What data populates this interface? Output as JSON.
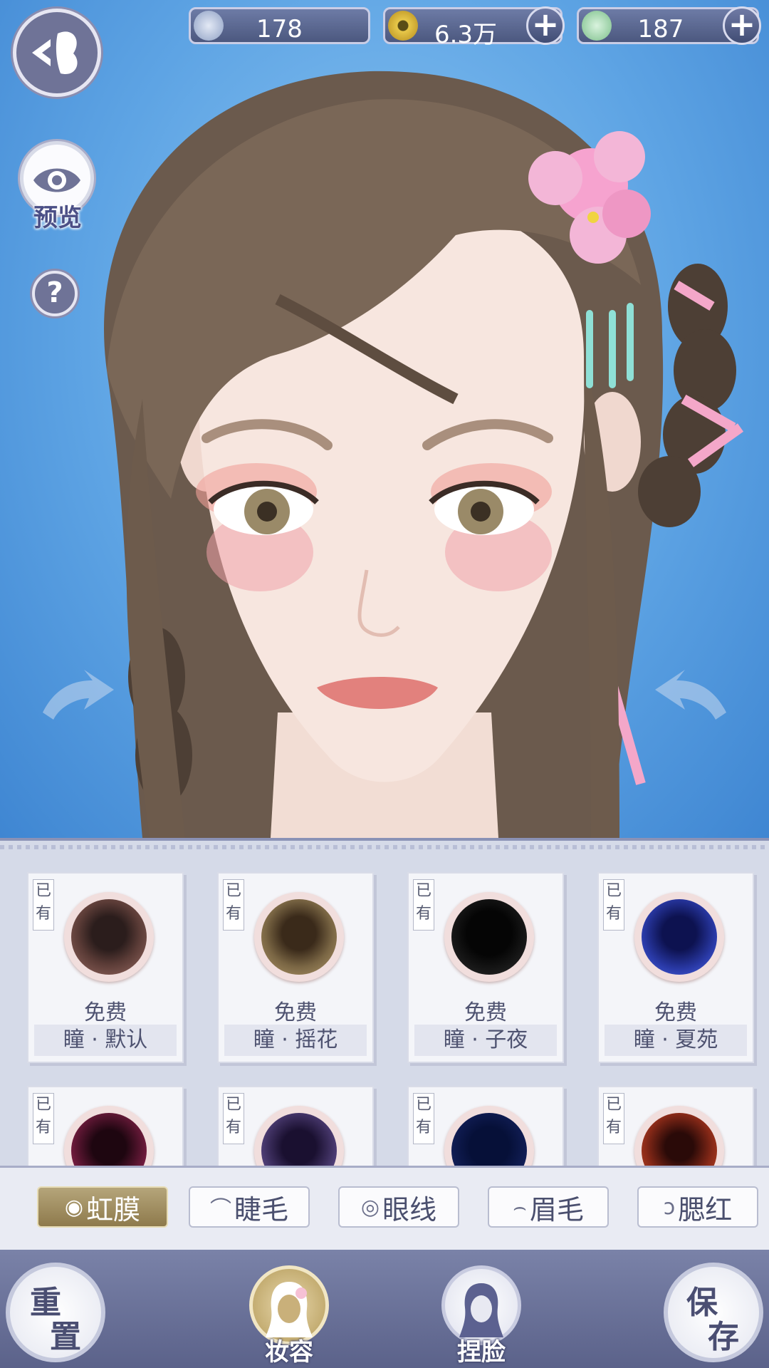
{
  "currency": [
    {
      "icon": "silver-coin-icon",
      "value": "178",
      "has_plus": false
    },
    {
      "icon": "gold-coin-icon",
      "value": "6.3万",
      "has_plus": true
    },
    {
      "icon": "jade-coin-icon",
      "value": "187",
      "has_plus": true
    }
  ],
  "left_controls": {
    "back_icon": "back-butterfly-icon",
    "preview_label": "预览",
    "help_label": "?"
  },
  "items_row1": [
    {
      "owned": "已有",
      "price": "免费",
      "name": "瞳 · 默认",
      "color_inner": "#2b1d1c",
      "color_ring": "#9a6b63"
    },
    {
      "owned": "已有",
      "price": "免费",
      "name": "瞳 · 摇花",
      "color_inner": "#3a2a1a",
      "color_ring": "#b39a6a"
    },
    {
      "owned": "已有",
      "price": "免费",
      "name": "瞳 · 子夜",
      "color_inner": "#050505",
      "color_ring": "#2e2e2e"
    },
    {
      "owned": "已有",
      "price": "免费",
      "name": "瞳 · 夏苑",
      "color_inner": "#0d1250",
      "color_ring": "#4d6be6"
    }
  ],
  "items_row2": [
    {
      "owned": "已有",
      "color_inner": "#1e0610",
      "color_ring": "#b0306a"
    },
    {
      "owned": "已有",
      "color_inner": "#1a1030",
      "color_ring": "#7a5aa8"
    },
    {
      "owned": "已有",
      "color_inner": "#061038",
      "color_ring": "#22357a"
    },
    {
      "owned": "已有",
      "color_inner": "#2a0a08",
      "color_ring": "#d0502a"
    }
  ],
  "tabs": [
    {
      "label": "虹膜",
      "icon": "iris-icon",
      "active": true
    },
    {
      "label": "睫毛",
      "icon": "eyelash-icon",
      "active": false
    },
    {
      "label": "眼线",
      "icon": "eyeliner-icon",
      "active": false
    },
    {
      "label": "眉毛",
      "icon": "eyebrow-icon",
      "active": false
    },
    {
      "label": "腮红",
      "icon": "blush-icon",
      "active": false
    }
  ],
  "bottom": {
    "reset_label_1": "重",
    "reset_label_2": "置",
    "makeup_label": "妆容",
    "face_label": "捏脸",
    "save_label_1": "保",
    "save_label_2": "存"
  }
}
